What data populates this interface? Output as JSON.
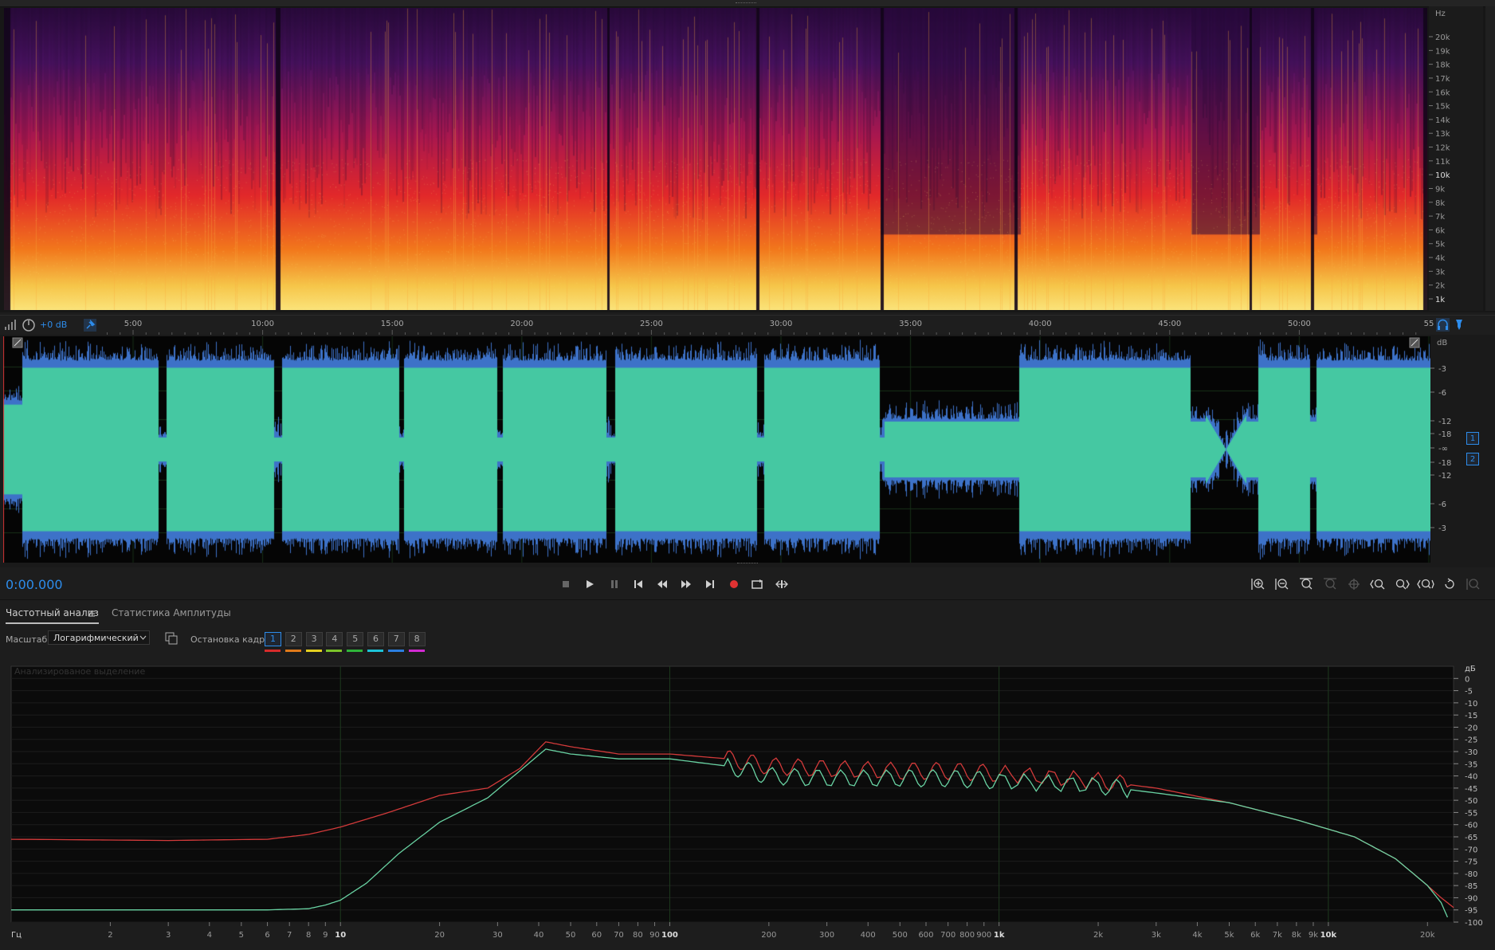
{
  "spectral": {
    "freq_unit": "Hz",
    "freq_labels": [
      "20k",
      "19k",
      "18k",
      "17k",
      "16k",
      "15k",
      "14k",
      "13k",
      "12k",
      "11k",
      "10k",
      "9k",
      "8k",
      "7k",
      "6k",
      "5k",
      "4k",
      "3k",
      "2k",
      "1k"
    ]
  },
  "timeline": {
    "volume": "+0 dB",
    "ticks": [
      "5:00",
      "10:00",
      "15:00",
      "20:00",
      "25:00",
      "30:00",
      "35:00",
      "40:00",
      "45:00",
      "50:00",
      "55"
    ]
  },
  "waveform": {
    "db_unit": "dB",
    "db_labels_top": [
      "-3",
      "-6",
      "-12",
      "-18",
      "-∞"
    ],
    "db_labels_bottom": [
      "-18",
      "-12",
      "-6",
      "-3"
    ],
    "channels": [
      "1",
      "2"
    ]
  },
  "transport": {
    "timecode": "0:00.000"
  },
  "analysis": {
    "tabs": [
      "Частотный анализ",
      "Статистика Амплитуды"
    ],
    "scale_label": "Масштаб:",
    "scale_value": "Логарифмический",
    "freeze_label": "Остановка кадра:",
    "frames": [
      "1",
      "2",
      "3",
      "4",
      "5",
      "6",
      "7",
      "8"
    ],
    "frame_colors": [
      "#d62b2b",
      "#e07a1a",
      "#e4d020",
      "#7cc42a",
      "#2fb53a",
      "#1dc3d8",
      "#2b7ee0",
      "#d22ad2"
    ],
    "overlay_text": "Анализированое выделение"
  },
  "chart_data": {
    "type": "line",
    "xscale": "log",
    "xlabel": "Гц",
    "ylabel": "дБ",
    "xlim": [
      1,
      24000
    ],
    "ylim": [
      -100,
      5
    ],
    "x_ticks": [
      {
        "v": 2,
        "t": "2"
      },
      {
        "v": 3,
        "t": "3"
      },
      {
        "v": 4,
        "t": "4"
      },
      {
        "v": 5,
        "t": "5"
      },
      {
        "v": 6,
        "t": "6"
      },
      {
        "v": 7,
        "t": "7"
      },
      {
        "v": 8,
        "t": "8"
      },
      {
        "v": 9,
        "t": "9"
      },
      {
        "v": 10,
        "t": "10",
        "major": true
      },
      {
        "v": 20,
        "t": "20"
      },
      {
        "v": 30,
        "t": "30"
      },
      {
        "v": 40,
        "t": "40"
      },
      {
        "v": 50,
        "t": "50"
      },
      {
        "v": 60,
        "t": "60"
      },
      {
        "v": 70,
        "t": "70"
      },
      {
        "v": 80,
        "t": "80"
      },
      {
        "v": 90,
        "t": "90"
      },
      {
        "v": 100,
        "t": "100",
        "major": true
      },
      {
        "v": 200,
        "t": "200"
      },
      {
        "v": 300,
        "t": "300"
      },
      {
        "v": 400,
        "t": "400"
      },
      {
        "v": 500,
        "t": "500"
      },
      {
        "v": 600,
        "t": "600"
      },
      {
        "v": 700,
        "t": "700"
      },
      {
        "v": 800,
        "t": "800"
      },
      {
        "v": 900,
        "t": "900"
      },
      {
        "v": 1000,
        "t": "1k",
        "major": true
      },
      {
        "v": 2000,
        "t": "2k"
      },
      {
        "v": 3000,
        "t": "3k"
      },
      {
        "v": 4000,
        "t": "4k"
      },
      {
        "v": 5000,
        "t": "5k"
      },
      {
        "v": 6000,
        "t": "6k"
      },
      {
        "v": 7000,
        "t": "7k"
      },
      {
        "v": 8000,
        "t": "8k"
      },
      {
        "v": 9000,
        "t": "9k"
      },
      {
        "v": 10000,
        "t": "10k",
        "major": true
      },
      {
        "v": 20000,
        "t": "20k"
      }
    ],
    "y_ticks": [
      0,
      -5,
      -10,
      -15,
      -20,
      -25,
      -30,
      -35,
      -40,
      -45,
      -50,
      -55,
      -60,
      -65,
      -70,
      -75,
      -80,
      -85,
      -90,
      -95,
      -100
    ],
    "series": [
      {
        "color": "#d23a3a",
        "x": [
          1,
          3,
          6,
          8,
          10,
          14,
          20,
          28,
          35,
          42,
          50,
          70,
          100,
          150,
          200,
          300,
          500,
          700,
          1000,
          2000,
          3000,
          5000,
          8000,
          12000,
          16000,
          20000,
          22000,
          24000
        ],
        "y": [
          -66,
          -66.5,
          -66,
          -64,
          -61,
          -55,
          -48,
          -45,
          -37,
          -26,
          -28,
          -31,
          -31,
          -33,
          -36,
          -37,
          -38,
          -38,
          -39,
          -42,
          -45,
          -51,
          -58,
          -65,
          -74,
          -85,
          -90,
          -94
        ]
      },
      {
        "color": "#69d3a3",
        "x": [
          1,
          3,
          6,
          8,
          9,
          10,
          12,
          15,
          20,
          28,
          35,
          42,
          50,
          70,
          100,
          150,
          200,
          300,
          500,
          700,
          1000,
          2000,
          3000,
          5000,
          8000,
          12000,
          16000,
          20000,
          22000,
          23000
        ],
        "y": [
          -95,
          -95,
          -95,
          -94.5,
          -93,
          -91,
          -84,
          -72,
          -59,
          -49,
          -38,
          -29,
          -31,
          -33,
          -33,
          -36,
          -40,
          -41,
          -41,
          -41,
          -42,
          -44,
          -47,
          -51,
          -58,
          -65,
          -74,
          -85,
          -92,
          -98
        ]
      }
    ]
  }
}
